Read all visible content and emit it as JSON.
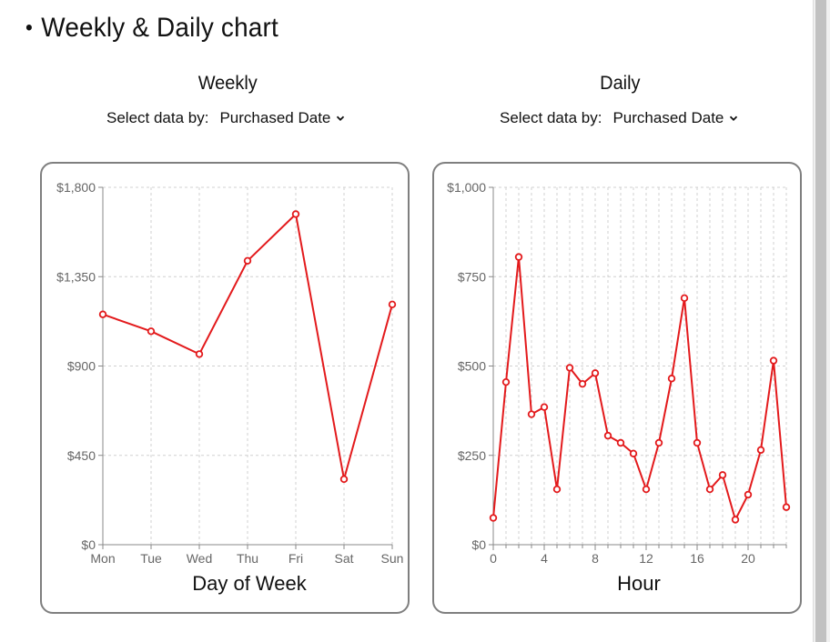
{
  "heading": {
    "bullet": "•",
    "title": "Weekly & Daily chart"
  },
  "weekly": {
    "title": "Weekly",
    "select_label": "Select data by:",
    "select_value": "Purchased Date"
  },
  "daily": {
    "title": "Daily",
    "select_label": "Select data by:",
    "select_value": "Purchased Date"
  },
  "colors": {
    "line": "#e31a1c",
    "grid": "#d0d0d0",
    "axis": "#888888",
    "border": "#7f7f7f"
  },
  "chart_data": [
    {
      "type": "line",
      "title": "Weekly",
      "xlabel": "Day of Week",
      "ylabel": "",
      "categories": [
        "Mon",
        "Tue",
        "Wed",
        "Thu",
        "Fri",
        "Sat",
        "Sun"
      ],
      "values": [
        1160,
        1075,
        960,
        1430,
        1665,
        330,
        1210
      ],
      "ylim": [
        0,
        1800
      ],
      "yticks": [
        "$0",
        "$450",
        "$900",
        "$1,350",
        "$1,800"
      ],
      "ytick_values": [
        0,
        450,
        900,
        1350,
        1800
      ],
      "grid": true
    },
    {
      "type": "line",
      "title": "Daily",
      "xlabel": "Hour",
      "ylabel": "",
      "x": [
        0,
        1,
        2,
        3,
        4,
        5,
        6,
        7,
        8,
        9,
        10,
        11,
        12,
        13,
        14,
        15,
        16,
        17,
        18,
        19,
        20,
        21,
        22,
        23
      ],
      "values": [
        75,
        455,
        805,
        365,
        385,
        155,
        495,
        450,
        480,
        305,
        285,
        255,
        155,
        285,
        465,
        690,
        285,
        155,
        195,
        70,
        140,
        265,
        515,
        105
      ],
      "xlim": [
        0,
        23
      ],
      "ylim": [
        0,
        1000
      ],
      "xticks": [
        "0",
        "4",
        "8",
        "12",
        "16",
        "20"
      ],
      "xtick_values": [
        0,
        4,
        8,
        12,
        16,
        20
      ],
      "yticks": [
        "$0",
        "$250",
        "$500",
        "$750",
        "$1,000"
      ],
      "ytick_values": [
        0,
        250,
        500,
        750,
        1000
      ],
      "grid": true
    }
  ]
}
